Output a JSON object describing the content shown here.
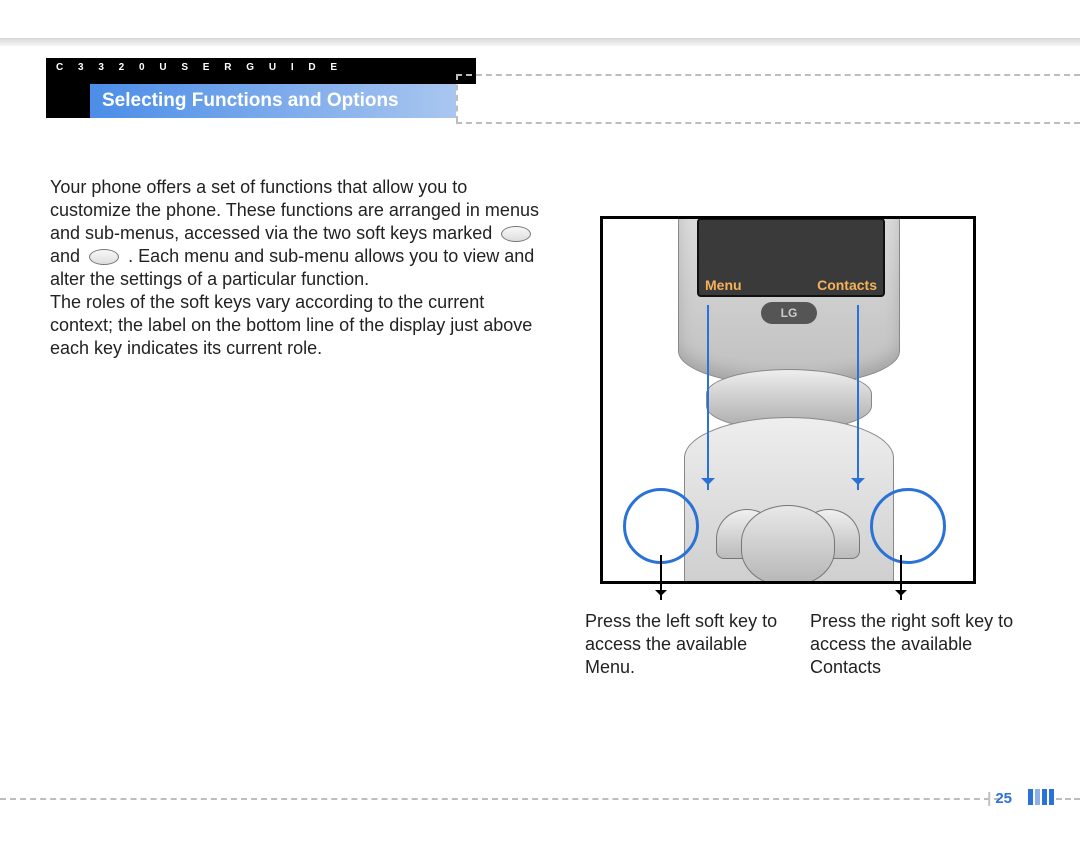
{
  "header": {
    "guide": "C 3 3 2 0   U S E R   G U I D E",
    "title": "Selecting Functions and Options"
  },
  "body": {
    "p1a": "Your phone offers a set of functions that allow you to customize the phone. These functions are arranged in menus and sub-menus, accessed via the two soft keys marked ",
    "p1b": " and ",
    "p1c": " . Each menu and sub-menu allows you to view and alter the settings of a particular function.",
    "p2": "The roles of the soft keys vary according to the current context; the label on the bottom line of the display just above each key indicates its current role."
  },
  "phone": {
    "left_label": "Menu",
    "right_label": "Contacts",
    "brand": "LG"
  },
  "captions": {
    "left": "Press the left soft key to access the available Menu.",
    "right": "Press the right soft key to access the available Contacts"
  },
  "footer": {
    "page": "25"
  }
}
